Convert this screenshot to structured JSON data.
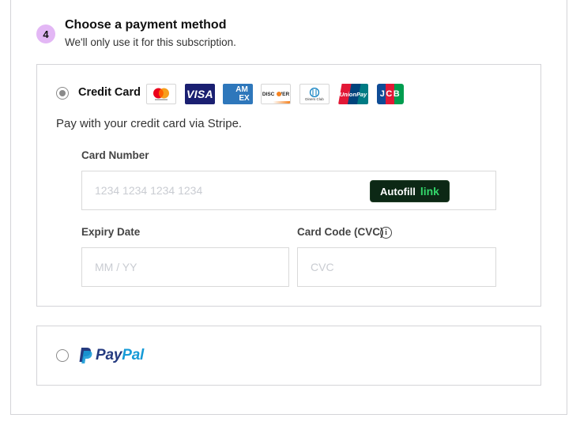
{
  "step": {
    "number": "4",
    "title": "Choose a payment method",
    "subtitle": "We'll only use it for this subscription."
  },
  "credit_card": {
    "label": "Credit Card",
    "selected": true,
    "description": "Pay with your credit card via Stripe.",
    "logos": [
      "mastercard-icon",
      "visa-icon",
      "amex-icon",
      "discover-icon",
      "diners-club-icon",
      "unionpay-icon",
      "jcb-icon"
    ],
    "logo_text": {
      "visa": "VISA",
      "amex_1": "AM",
      "amex_2": "EX",
      "discover": "DISC   VER",
      "diners": "Diners Club",
      "unionpay": "UnionPay",
      "jcb": "JCB"
    },
    "card_number": {
      "label": "Card Number",
      "placeholder": "1234 1234 1234 1234",
      "autofill_text": "Autofill",
      "autofill_link": "link"
    },
    "expiry": {
      "label": "Expiry Date",
      "placeholder": "MM / YY"
    },
    "cvc": {
      "label": "Card Code (CVC)",
      "placeholder": "CVC",
      "info_glyph": "i"
    }
  },
  "paypal": {
    "selected": false,
    "logo_text_1": "Pay",
    "logo_text_2": "Pal"
  },
  "colors": {
    "badge": "#e3b7f5",
    "autofill_bg": "#0c2815",
    "link_green": "#33d86b",
    "paypal_dark": "#253b80",
    "paypal_light": "#179bd7"
  }
}
